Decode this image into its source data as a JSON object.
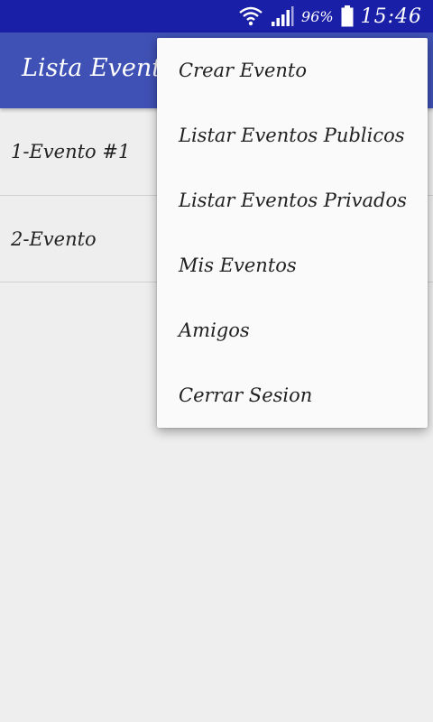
{
  "status_bar": {
    "battery_percent": "96%",
    "time": "15:46",
    "icons": [
      "wifi-icon",
      "signal-icon",
      "battery-icon"
    ]
  },
  "app_bar": {
    "title": "Lista Eventos"
  },
  "events": [
    {
      "label": "1-Evento #1"
    },
    {
      "label": "2-Evento"
    }
  ],
  "menu": {
    "items": [
      {
        "label": "Crear Evento"
      },
      {
        "label": "Listar Eventos Publicos"
      },
      {
        "label": "Listar Eventos Privados"
      },
      {
        "label": "Mis Eventos"
      },
      {
        "label": "Amigos"
      },
      {
        "label": "Cerrar Sesion"
      }
    ]
  },
  "colors": {
    "status_bar": "#1a1fa8",
    "app_bar": "#3f51b5",
    "background": "#eeeeee",
    "menu_background": "#fafafa"
  }
}
